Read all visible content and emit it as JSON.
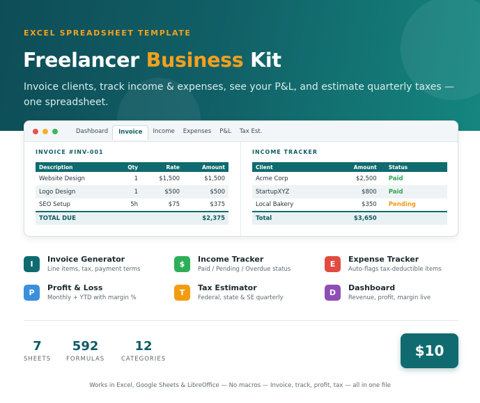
{
  "hero": {
    "eyebrow": "EXCEL SPREADSHEET TEMPLATE",
    "title_part1": "Freelancer ",
    "title_accent": "Business",
    "title_part2": " Kit",
    "subtitle": "Invoice clients, track income & expenses, see your P&L, and estimate quarterly taxes — one spreadsheet."
  },
  "app": {
    "tabs": [
      "Dashboard",
      "Invoice",
      "Income",
      "Expenses",
      "P&L",
      "Tax Est."
    ],
    "active_tab": "Invoice",
    "invoice": {
      "title": "INVOICE #INV-001",
      "headers": [
        "Description",
        "Qty",
        "Rate",
        "Amount"
      ],
      "rows": [
        [
          "Website Design",
          "1",
          "$1,500",
          "$1,500"
        ],
        [
          "Logo Design",
          "1",
          "$500",
          "$500"
        ],
        [
          "SEO Setup",
          "5h",
          "$75",
          "$375"
        ]
      ],
      "total_label": "TOTAL DUE",
      "total_value": "$2,375"
    },
    "income": {
      "title": "INCOME TRACKER",
      "headers": [
        "Client",
        "Amount",
        "Status"
      ],
      "rows": [
        [
          "Acme Corp",
          "$2,500",
          "Paid"
        ],
        [
          "StartupXYZ",
          "$800",
          "Paid"
        ],
        [
          "Local Bakery",
          "$350",
          "Pending"
        ]
      ],
      "total_label": "Total",
      "total_value": "$3,650"
    }
  },
  "features": [
    {
      "letter": "I",
      "title": "Invoice Generator",
      "desc": "Line items, tax, payment terms",
      "color": "#0f6b6f"
    },
    {
      "letter": "$",
      "title": "Income Tracker",
      "desc": "Paid / Pending / Overdue status",
      "color": "#2fae5a"
    },
    {
      "letter": "E",
      "title": "Expense Tracker",
      "desc": "Auto-flags tax-deductible items",
      "color": "#e24b3f"
    },
    {
      "letter": "P",
      "title": "Profit & Loss",
      "desc": "Monthly + YTD with margin %",
      "color": "#3b8fdc"
    },
    {
      "letter": "T",
      "title": "Tax Estimator",
      "desc": "Federal, state & SE quarterly",
      "color": "#f39c12"
    },
    {
      "letter": "D",
      "title": "Dashboard",
      "desc": "Revenue, profit, margin live",
      "color": "#8e4fb5"
    }
  ],
  "stats": [
    {
      "value": "7",
      "label": "SHEETS"
    },
    {
      "value": "592",
      "label": "FORMULAS"
    },
    {
      "value": "12",
      "label": "CATEGORIES"
    }
  ],
  "price": "$10",
  "footer": "Works in Excel, Google Sheets & LibreOffice — No macros — Invoice, track, profit, tax — all in one file"
}
